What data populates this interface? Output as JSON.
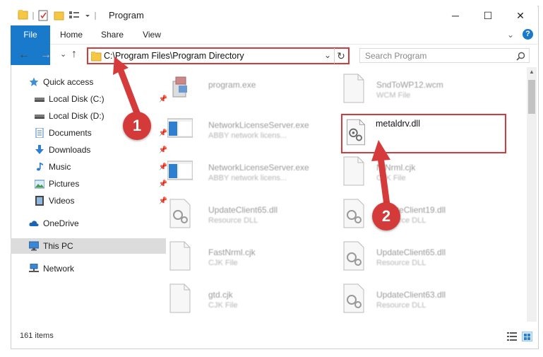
{
  "window": {
    "title": "Program",
    "minimize": "─",
    "maximize": "☐",
    "close": "✕"
  },
  "ribbon": {
    "tabs": [
      "File",
      "Home",
      "Share",
      "View"
    ],
    "expand": "⌄",
    "help": "?"
  },
  "nav": {
    "back": "←",
    "forward": "→",
    "recent": "⌄",
    "up": "↑",
    "address": "C:\\Program Files\\Program Directory",
    "address_dropdown": "⌄",
    "refresh": "↻",
    "search_placeholder": "Search Program"
  },
  "sidebar": {
    "items": [
      {
        "label": "Quick access",
        "icon": "star-icon",
        "pinned": false
      },
      {
        "label": "Local Disk (C:)",
        "icon": "drive-icon",
        "pinned": true
      },
      {
        "label": "Local Disk (D:)",
        "icon": "drive-icon",
        "pinned": false
      },
      {
        "label": "Documents",
        "icon": "documents-icon",
        "pinned": true
      },
      {
        "label": "Downloads",
        "icon": "downloads-icon",
        "pinned": true
      },
      {
        "label": "Music",
        "icon": "music-icon",
        "pinned": true
      },
      {
        "label": "Pictures",
        "icon": "pictures-icon",
        "pinned": true
      },
      {
        "label": "Videos",
        "icon": "videos-icon",
        "pinned": true
      },
      {
        "label": "OneDrive",
        "icon": "cloud-icon",
        "pinned": false
      },
      {
        "label": "This PC",
        "icon": "computer-icon",
        "pinned": false
      },
      {
        "label": "Network",
        "icon": "network-icon",
        "pinned": false
      }
    ],
    "pin_glyph": "📌"
  },
  "files": {
    "left": [
      {
        "name": "program.exe",
        "type": "",
        "icon": "exe-icon"
      },
      {
        "name": "NetworkLicenseServer.exe",
        "type": "ABBY network licens...",
        "icon": "app-window-icon"
      },
      {
        "name": "NetworkLicenseServer.exe",
        "type": "ABBY network licens...",
        "icon": "app-window-icon"
      },
      {
        "name": "UpdateClient65.dll",
        "type": "Resource DLL",
        "icon": "dll-icon"
      },
      {
        "name": "FastNrml.cjk",
        "type": "CJK File",
        "icon": "file-icon"
      },
      {
        "name": "gtd.cjk",
        "type": "CJK File",
        "icon": "file-icon"
      }
    ],
    "right": [
      {
        "name": "SndToWP12.wcm",
        "type": "WCM File",
        "icon": "file-icon"
      },
      {
        "name": "metaldrv.dll",
        "type": "",
        "icon": "dll-icon"
      },
      {
        "name": "NtNrml.cjk",
        "type": "CJK File",
        "icon": "file-icon"
      },
      {
        "name": "UpdateClient19.dll",
        "type": "Resource DLL",
        "icon": "dll-icon"
      },
      {
        "name": "UpdateClient65.dll",
        "type": "Resource DLL",
        "icon": "dll-icon"
      },
      {
        "name": "UpdateClient63.dll",
        "type": "Resource DLL",
        "icon": "dll-icon"
      }
    ]
  },
  "status": {
    "count": "161 items"
  },
  "annotations": {
    "badge1": "1",
    "badge2": "2"
  },
  "colors": {
    "accent": "#1979ca",
    "highlight": "#d63b3b",
    "selected": "#cce8ff"
  }
}
